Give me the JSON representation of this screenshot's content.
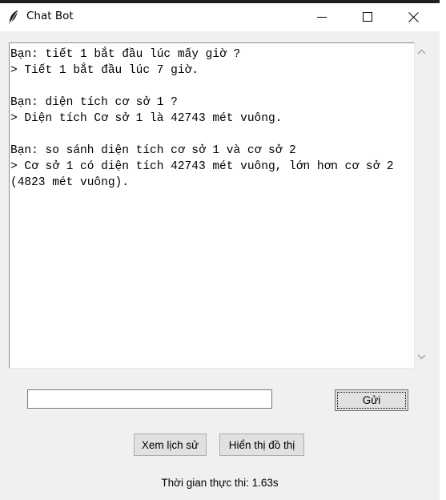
{
  "window": {
    "title": "Chat Bot",
    "app_icon": "feather-icon",
    "controls": {
      "minimize": "minimize-icon",
      "maximize": "maximize-icon",
      "close": "close-icon"
    }
  },
  "chat": {
    "lines": [
      "Bạn: tiết 1 bắt đầu lúc mấy giờ ?",
      "> Tiết 1 bắt đầu lúc 7 giờ.",
      "",
      "Bạn: diện tích cơ sở 1 ?",
      "> Diện tích Cơ sở 1 là 42743 mét vuông.",
      "",
      "Bạn: so sánh diện tích cơ sở 1 và cơ sở 2",
      "> Cơ sở 1 có diện tích 42743 mét vuông, lớn hơn cơ sở 2 (4823 mét vuông)."
    ]
  },
  "input": {
    "value": ""
  },
  "buttons": {
    "send": "Gửi",
    "history": "Xem lịch sử",
    "chart": "Hiển thị đồ thị"
  },
  "status": {
    "exec_time": "Thời gian thực thi: 1.63s"
  }
}
